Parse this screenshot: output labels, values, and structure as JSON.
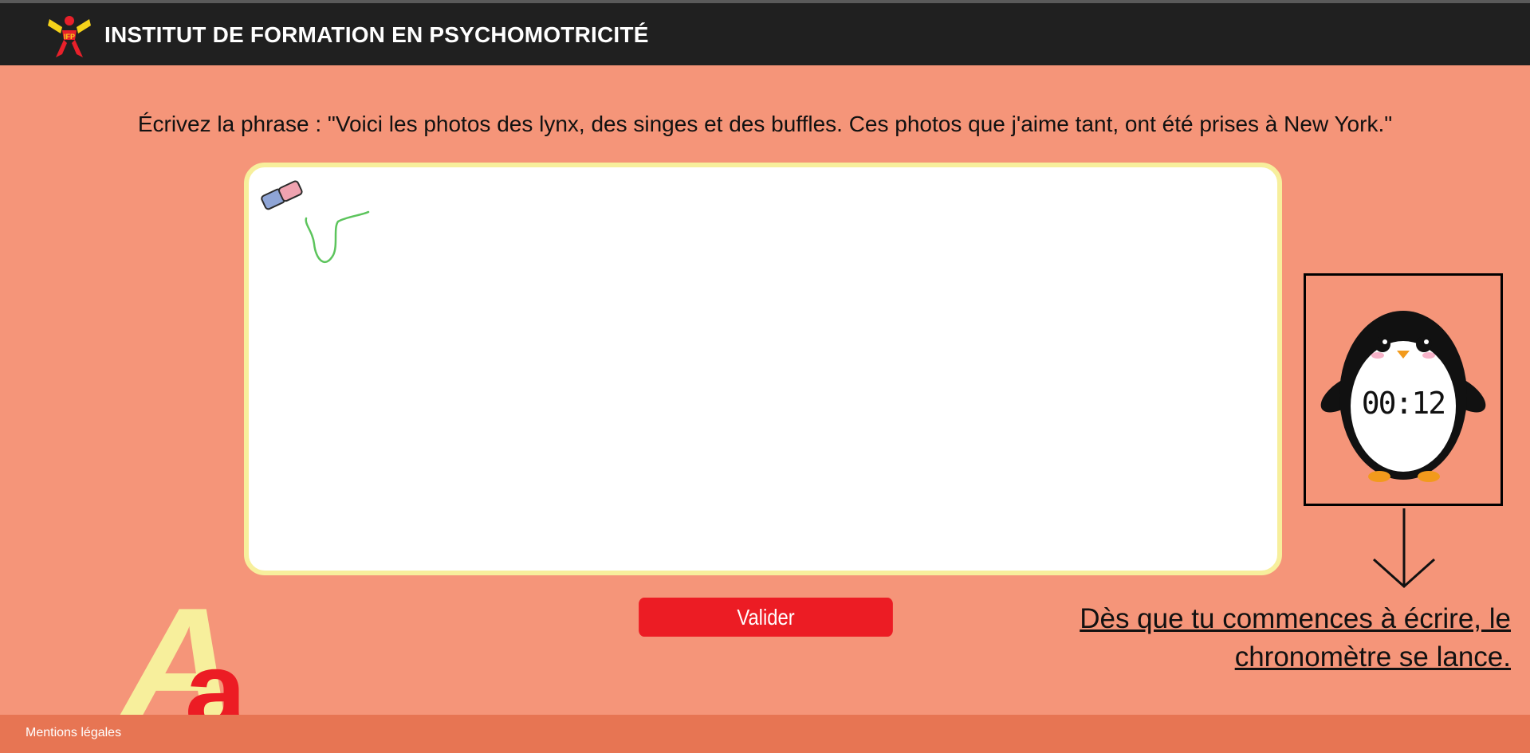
{
  "header": {
    "title": "INSTITUT DE FORMATION EN PSYCHOMOTRICITÉ",
    "logo_text": "IFP",
    "logo_icon": "ifp-logo-icon",
    "background": "#202020"
  },
  "main": {
    "instruction": "Écrivez la phrase : \"Voici les photos des lynx, des singes et des buffles. Ces photos que j'aime tant, ont été prises à New York.\"",
    "eraser_icon": "eraser-icon",
    "validate_label": "Valider",
    "background": "#f59579",
    "canvas_border": "#f7ef9c",
    "button_color": "#ec1c24"
  },
  "timer": {
    "value": "00:12",
    "mascot_icon": "penguin-icon",
    "arrow_icon": "arrow-down-icon"
  },
  "hint": {
    "line1": "Dès que tu commences à écrire, le",
    "line2": "chronomètre se lance."
  },
  "decor": {
    "big_letter": "A",
    "small_letter": "a",
    "big_color": "#f7ef9c",
    "small_color": "#ec1c24"
  },
  "footer": {
    "link_label": "Mentions légales",
    "background": "#e77553"
  }
}
